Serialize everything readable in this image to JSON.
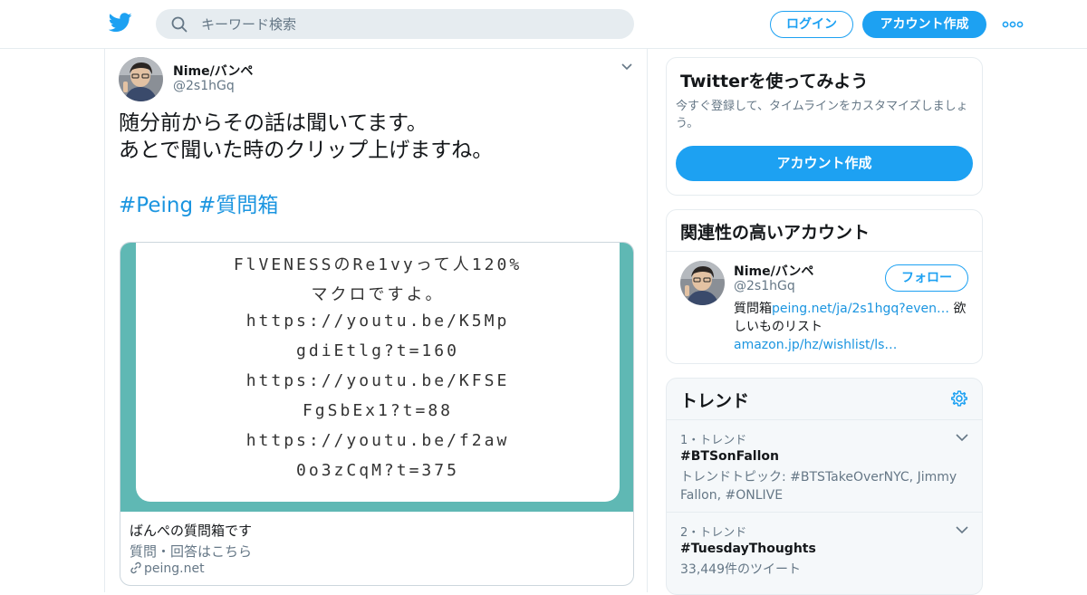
{
  "header": {
    "search_placeholder": "キーワード検索",
    "login_label": "ログイン",
    "signup_label": "アカウント作成",
    "brand_color": "#1da1f2"
  },
  "tweet": {
    "display_name": "Nime/バンペ",
    "handle": "@2s1hGq",
    "text_lines": [
      "随分前からその話は聞いてます。",
      "あとで聞いた時のクリップ上げますね。"
    ],
    "hashtags": [
      "#Peing",
      "#質問箱"
    ],
    "card": {
      "image_lines": [
        "FlVENESSのRe1vyって人120%",
        "マクロですよ。",
        "https://youtu.be/K5Mp",
        "gdiEtlg?t=160",
        "https://youtu.be/KFSE",
        "FgSbEx1?t=88",
        "https://youtu.be/f2aw",
        "0o3zCqM?t=375"
      ],
      "title": "ばんぺの質問箱です",
      "description": "質問・回答はこちら",
      "domain": "peing.net"
    }
  },
  "signup_module": {
    "title": "Twitterを使ってみよう",
    "description": "今すぐ登録して、タイムラインをカスタマイズしましょう。",
    "button_label": "アカウント作成"
  },
  "related_module": {
    "title": "関連性の高いアカウント",
    "account": {
      "display_name": "Nime/バンペ",
      "handle": "@2s1hGq",
      "follow_label": "フォロー",
      "bio_prefix": "質問箱",
      "bio_link1": "peing.net/ja/2s1hgq?even…",
      "bio_middle": " 欲しいものリスト",
      "bio_link2": "amazon.jp/hz/wishlist/ls…"
    }
  },
  "trends_module": {
    "title": "トレンド",
    "trends": [
      {
        "rank": "1・トレンド",
        "name": "#BTSonFallon",
        "meta": "トレンドトピック: #BTSTakeOverNYC, Jimmy Fallon, #ONLIVE"
      },
      {
        "rank": "2・トレンド",
        "name": "#TuesdayThoughts",
        "meta": "33,449件のツイート"
      }
    ]
  }
}
